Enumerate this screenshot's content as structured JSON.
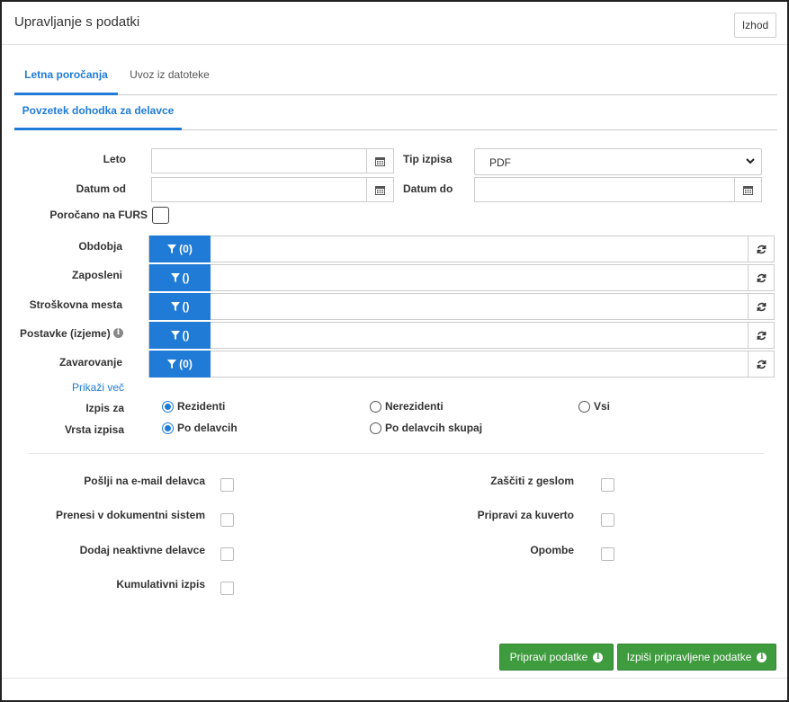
{
  "header": {
    "title": "Upravljanje s podatki",
    "exit_label": "Izhod"
  },
  "tabs": [
    {
      "label": "Letna poročanja",
      "active": true
    },
    {
      "label": "Uvoz iz datoteke",
      "active": false
    }
  ],
  "subtab": {
    "label": "Povzetek dohodka za delavce"
  },
  "form": {
    "year_label": "Leto",
    "year_value": "",
    "print_type_label": "Tip izpisa",
    "print_type_value": "PDF",
    "date_from_label": "Datum od",
    "date_from_value": "",
    "date_to_label": "Datum do",
    "date_to_value": "",
    "furs_label": "Poročano na FURS"
  },
  "filters": [
    {
      "label": "Obdobja",
      "count": "(0)"
    },
    {
      "label": "Zaposleni",
      "count": "()"
    },
    {
      "label": "Stroškovna mesta",
      "count": "()"
    },
    {
      "label": "Postavke (izjeme)",
      "count": "()"
    },
    {
      "label": "Zavarovanje",
      "count": "(0)"
    }
  ],
  "show_more": "Prikaži več",
  "print_for": {
    "label": "Izpis za",
    "options": [
      {
        "label": "Rezidenti",
        "selected": true
      },
      {
        "label": "Nerezidenti",
        "selected": false
      },
      {
        "label": "Vsi",
        "selected": false
      }
    ]
  },
  "print_kind": {
    "label": "Vrsta izpisa",
    "options": [
      {
        "label": "Po delavcih",
        "selected": true
      },
      {
        "label": "Po delavcih skupaj",
        "selected": false
      }
    ]
  },
  "options": {
    "send_email": "Pošlji na e-mail delavca",
    "transfer_dms": "Prenesi v dokumentni sistem",
    "add_inactive": "Dodaj neaktivne delavce",
    "cumulative": "Kumulativni izpis",
    "password": "Zaščiti z geslom",
    "envelope": "Pripravi za kuverto",
    "notes": "Opombe"
  },
  "actions": {
    "prepare": "Pripravi podatke",
    "print_prepared": "Izpiši pripravljene podatke"
  },
  "colors": {
    "primary": "#1f7bd6",
    "success": "#3e9b3e"
  }
}
